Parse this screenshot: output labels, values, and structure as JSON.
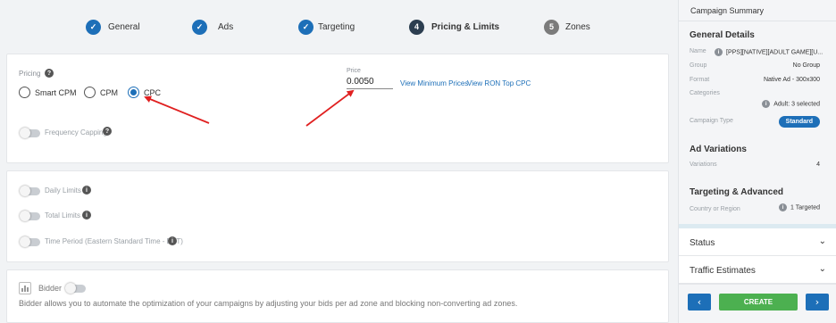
{
  "stepper": {
    "steps": [
      {
        "label": "General",
        "marker": "✓",
        "state": "done"
      },
      {
        "label": "Ads",
        "marker": "✓",
        "state": "done"
      },
      {
        "label": "Targeting",
        "marker": "✓",
        "state": "done"
      },
      {
        "label": "Pricing & Limits",
        "marker": "4",
        "state": "current"
      },
      {
        "label": "Zones",
        "marker": "5",
        "state": "pending"
      }
    ]
  },
  "pricing": {
    "label": "Pricing",
    "help": "?",
    "options": [
      "Smart CPM",
      "CPM",
      "CPC"
    ],
    "selected": "CPC",
    "price_label": "Price",
    "price_value": "0.0050",
    "min_prices_link": "View Minimum Prices",
    "ron_link": "View RON Top CPC",
    "frequency_capping": "Frequency Capping"
  },
  "limits": {
    "daily": "Daily Limits",
    "total": "Total Limits",
    "time_period": "Time Period (Eastern Standard Time - EST)",
    "info": "i"
  },
  "bidder": {
    "label": "Bidder",
    "description": "Bidder allows you to automate the optimization of your campaigns by adjusting your bids per ad zone and blocking non-converting ad zones."
  },
  "sidebar": {
    "title": "Campaign Summary",
    "general_details": "General Details",
    "name_key": "Name",
    "name_val": "[PPS][NATIVE][ADULT GAME][U...",
    "group_key": "Group",
    "group_val": "No Group",
    "format_key": "Format",
    "format_val": "Native Ad - 300x300",
    "categories_key": "Categories",
    "categories_val": "Adult: 3 selected",
    "campaign_type_key": "Campaign Type",
    "campaign_type_val": "Standard",
    "ad_variations": "Ad Variations",
    "variations_key": "Variations",
    "variations_val": "4",
    "targeting_advanced": "Targeting & Advanced",
    "country_key": "Country or Region",
    "country_val": "1 Targeted",
    "info": "i",
    "status": "Status",
    "traffic_estimates": "Traffic Estimates",
    "chevron": "⌄",
    "prev": "‹",
    "next": "›",
    "create": "CREATE"
  },
  "colors": {
    "accent": "#1d6fb8",
    "create": "#4cb050",
    "annotation": "#e02020"
  }
}
